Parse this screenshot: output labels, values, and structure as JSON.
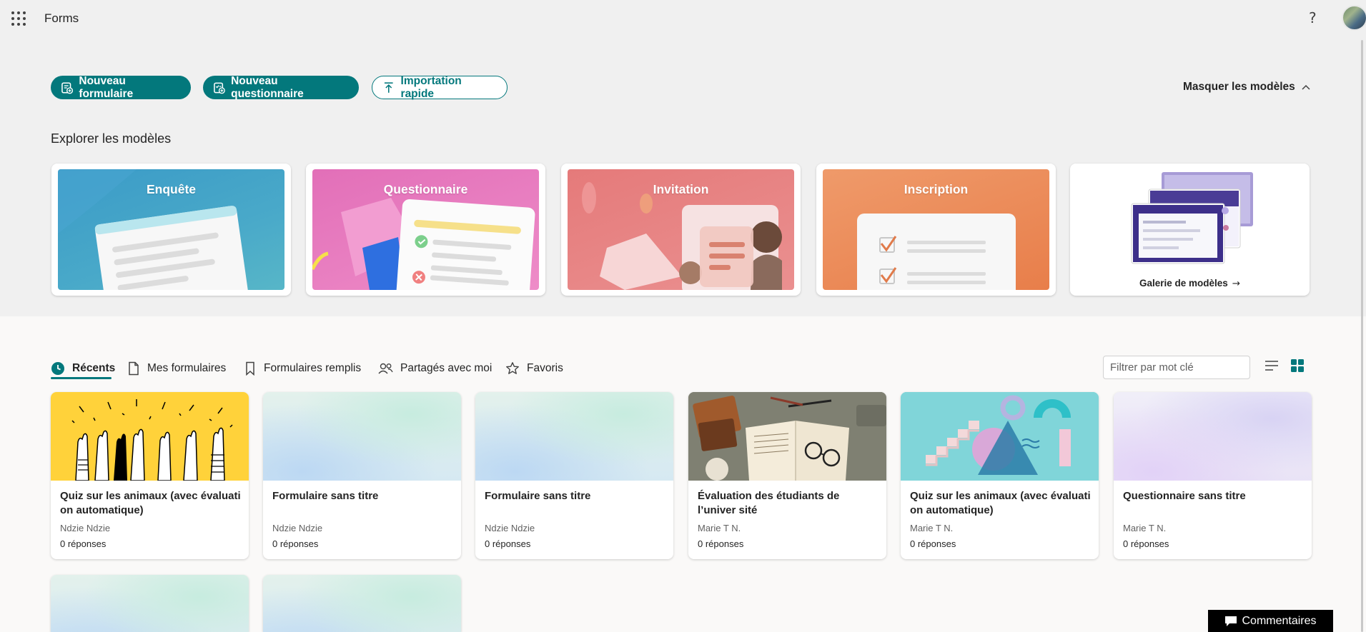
{
  "header": {
    "app_title": "Forms",
    "help_label": "?"
  },
  "actions": {
    "new_form": "Nouveau formulaire",
    "new_quiz": "Nouveau questionnaire",
    "quick_import": "Importation rapide",
    "hide_templates": "Masquer les modèles"
  },
  "templates": {
    "section_title": "Explorer les modèles",
    "items": [
      {
        "label": "Enquête"
      },
      {
        "label": "Questionnaire"
      },
      {
        "label": "Invitation"
      },
      {
        "label": "Inscription"
      }
    ],
    "gallery_label": "Galerie de modèles"
  },
  "tabs": [
    {
      "label": "Récents",
      "active": true
    },
    {
      "label": "Mes formulaires"
    },
    {
      "label": "Formulaires remplis"
    },
    {
      "label": "Partagés avec moi"
    },
    {
      "label": "Favoris"
    }
  ],
  "filter": {
    "placeholder": "Filtrer par mot clé"
  },
  "forms": [
    {
      "title": "Quiz sur les animaux (avec évaluati on automatique)",
      "owner": "Ndzie Ndzie",
      "responses": "0 réponses"
    },
    {
      "title": "Formulaire sans titre",
      "owner": "Ndzie Ndzie",
      "responses": "0 réponses"
    },
    {
      "title": "Formulaire sans titre",
      "owner": "Ndzie Ndzie",
      "responses": "0 réponses"
    },
    {
      "title": "Évaluation des étudiants de l’univer sité",
      "owner": "Marie T N.",
      "responses": "0 réponses"
    },
    {
      "title": "Quiz sur les animaux (avec évaluati on automatique)",
      "owner": "Marie T N.",
      "responses": "0 réponses"
    },
    {
      "title": "Questionnaire sans titre",
      "owner": "Marie T N.",
      "responses": "0 réponses"
    }
  ],
  "feedback": {
    "label": "Commentaires"
  },
  "colors": {
    "accent": "#03787c",
    "header_bg": "#f0f0f0",
    "content_bg": "#faf9f8"
  }
}
